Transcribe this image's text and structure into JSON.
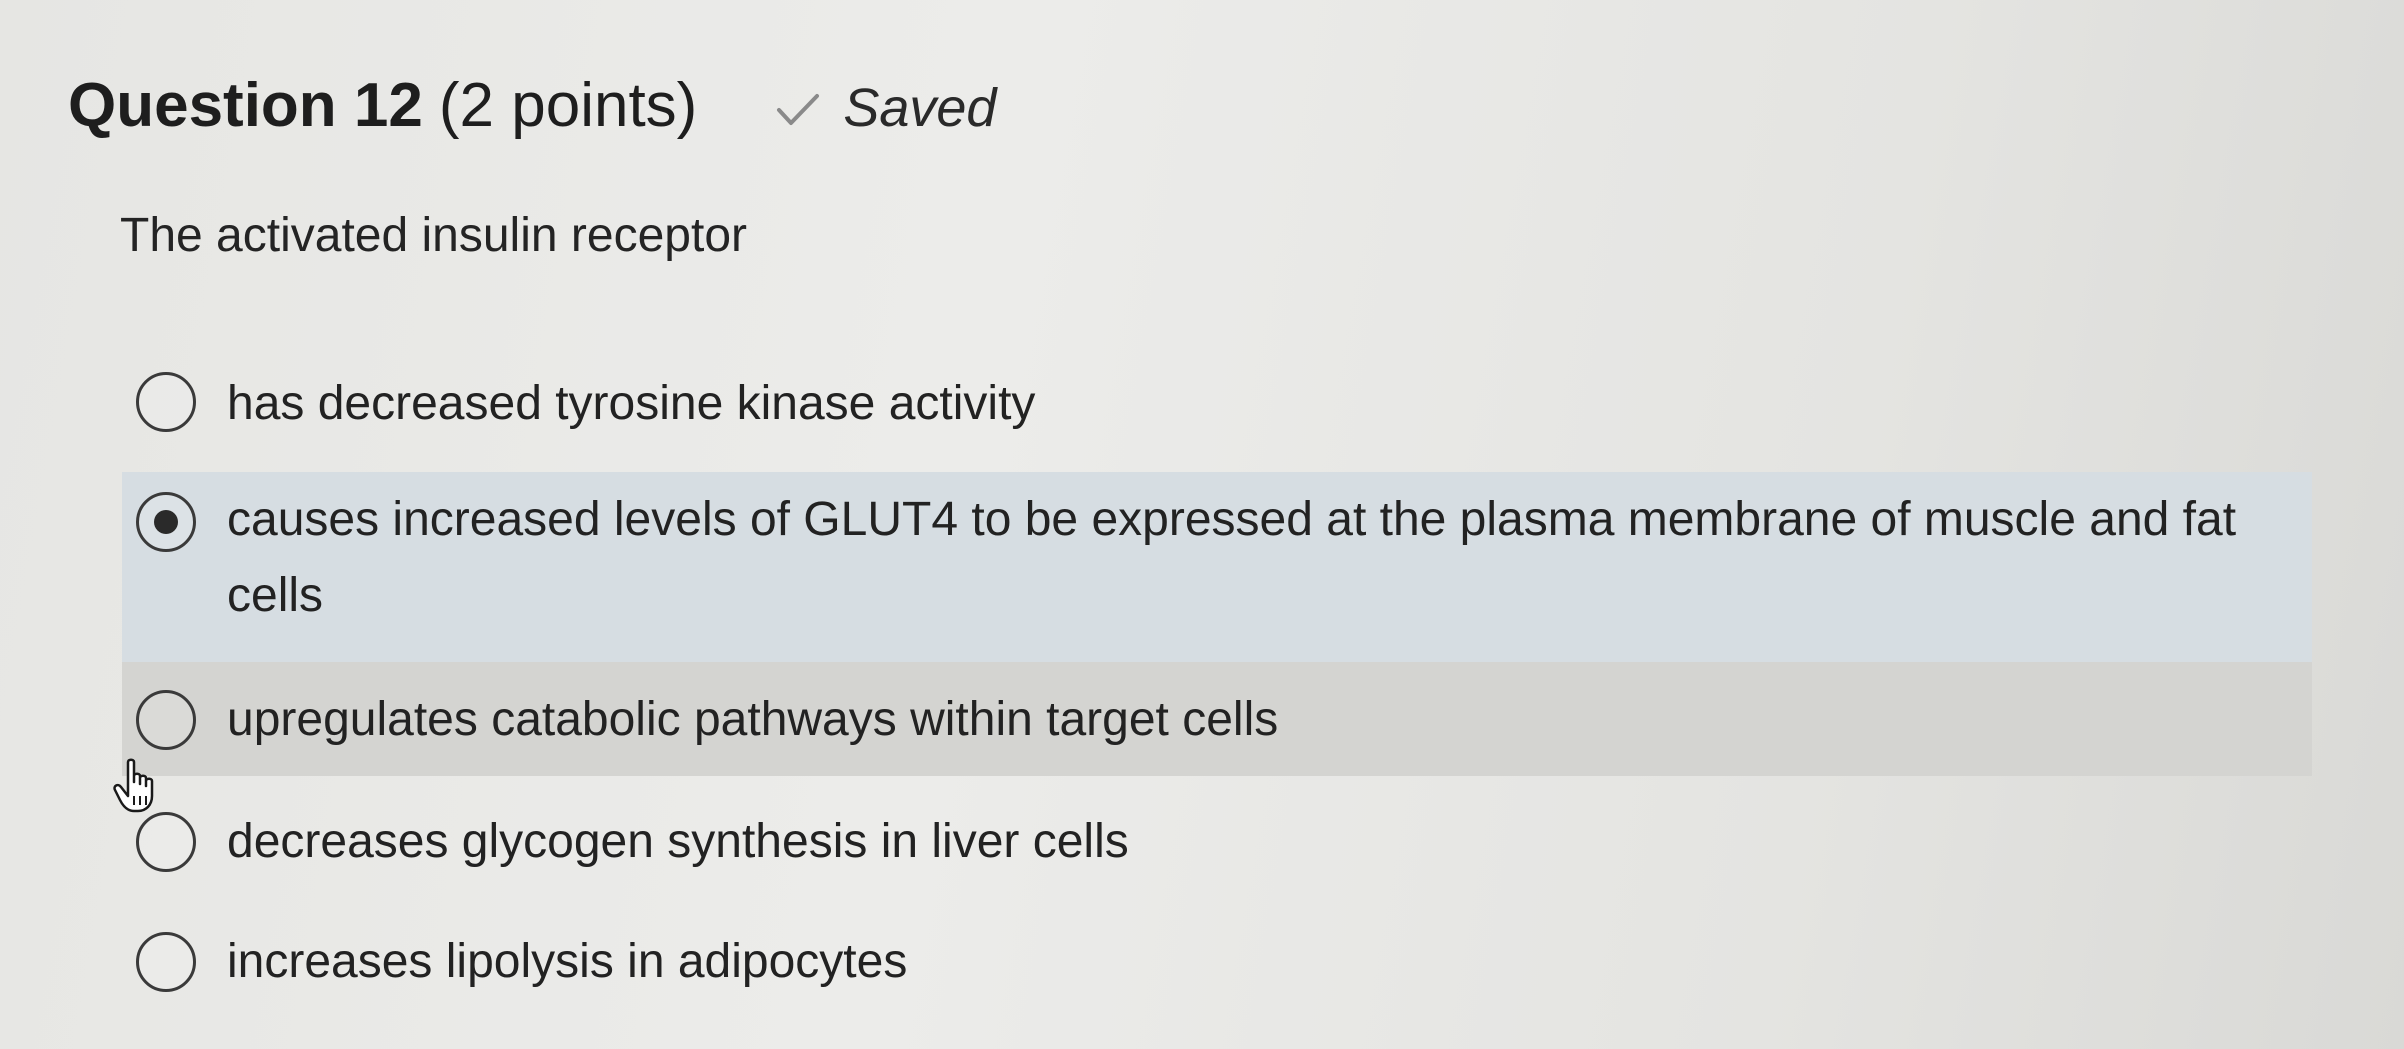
{
  "question": {
    "title": "Question 12",
    "points": "(2 points)",
    "saved_label": "Saved",
    "stem": "The activated insulin receptor"
  },
  "options": [
    {
      "text": "has decreased tyrosine kinase activity",
      "selected": false
    },
    {
      "text": "causes increased levels of GLUT4 to be expressed at the plasma membrane of muscle and fat cells",
      "selected": true
    },
    {
      "text": "upregulates catabolic pathways within target cells",
      "selected": false
    },
    {
      "text": "decreases glycogen synthesis in liver cells",
      "selected": false
    },
    {
      "text": "increases lipolysis in adipocytes",
      "selected": false
    }
  ],
  "icons": {
    "saved": "check-icon",
    "pointer": "hand-cursor-icon"
  },
  "colors": {
    "selected_background": "#d6dde2",
    "hover_background": "#d4d4d1"
  }
}
